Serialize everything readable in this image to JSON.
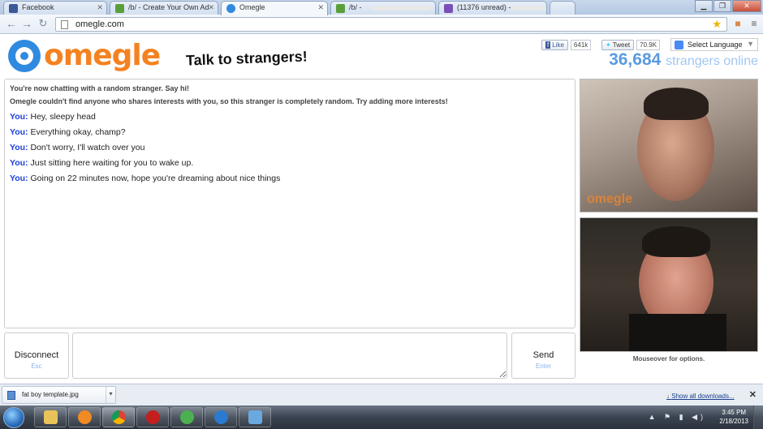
{
  "browser": {
    "tabs": [
      {
        "label": "Facebook",
        "color": "#3b5998"
      },
      {
        "label": "/b/ - Create Your Own Ad",
        "color": "#5a9e3a"
      },
      {
        "label": "Omegle",
        "color": "#2f8ae0",
        "active": true
      },
      {
        "label": "/b/ -",
        "color": "#5a9e3a"
      },
      {
        "label": "(11376 unread) -",
        "color": "#7b4fb5"
      }
    ],
    "url": "omegle.com"
  },
  "header": {
    "logo": "omegle",
    "tagline": "Talk to strangers!",
    "fb_like": "Like",
    "fb_count": "641k",
    "tweet": "Tweet",
    "tweet_count": "70.9K",
    "language": "Select Language",
    "online_count": "36,684",
    "online_label": "strangers online"
  },
  "chat": {
    "system": [
      "You're now chatting with a random stranger. Say hi!",
      "Omegle couldn't find anyone who shares interests with you, so this stranger is completely random. Try adding more interests!"
    ],
    "speaker": "You:",
    "messages": [
      "Hey, sleepy head",
      "Everything okay, champ?",
      "Don't worry, I'll watch over you",
      "Just sitting here waiting for you to wake up.",
      "Going on 22 minutes now, hope you're dreaming about nice things"
    ]
  },
  "video": {
    "watermark": "omegle",
    "hint": "Mouseover for options."
  },
  "controls": {
    "disconnect": "Disconnect",
    "disconnect_key": "Esc",
    "send": "Send",
    "send_key": "Enter"
  },
  "downloads": {
    "file": "fat boy template.jpg",
    "show_all": "Show all downloads..."
  },
  "taskbar": {
    "time": "3:45 PM",
    "date": "2/18/2013"
  }
}
